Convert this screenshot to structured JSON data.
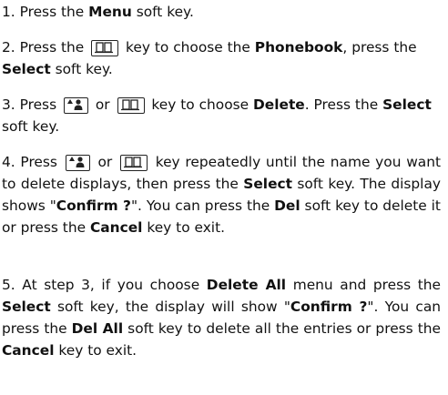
{
  "steps": [
    {
      "number": "1.",
      "t1": " Press the ",
      "b1": "Menu",
      "t2": " soft key."
    },
    {
      "number": "2.",
      "t1": " Press the ",
      "t2": " key to choose the ",
      "b1": "Phonebook",
      "t3": ", press the ",
      "b2": "Select",
      "t4": " soft key."
    },
    {
      "number": "3.",
      "t1": " Press ",
      "t2": " or ",
      "t3": " key to choose ",
      "b1": "Delete",
      "t4": ". Press the ",
      "b2": "Select",
      "t5": " soft key."
    },
    {
      "number": "4.",
      "t1": " Press ",
      "t2": " or ",
      "t3": " key repeatedly until the name you want to delete displays, then press the ",
      "b1": "Select",
      "t4": " soft key. The display shows \"",
      "b2": "Confirm ?",
      "t5": "\". You can press the ",
      "b3": "Del",
      "t6": " soft key to delete it or press the ",
      "b4": "Cancel",
      "t7": " key to exit."
    },
    {
      "number": "5.",
      "t1": " At step 3, if you choose ",
      "b1": "Delete All",
      "t2": " menu and press the ",
      "b2": "Select",
      "t3": " soft key, the display will show \"",
      "b3": "Confirm ?",
      "t4": "\". You can press the ",
      "b4": "Del All",
      "t5": " soft key to delete all the entries or press the ",
      "b5": "Cancel",
      "t6": " key to exit."
    }
  ],
  "icons": {
    "phonebook_key": "phonebook-key-icon",
    "up_key": "up-arrow-contact-key-icon"
  }
}
